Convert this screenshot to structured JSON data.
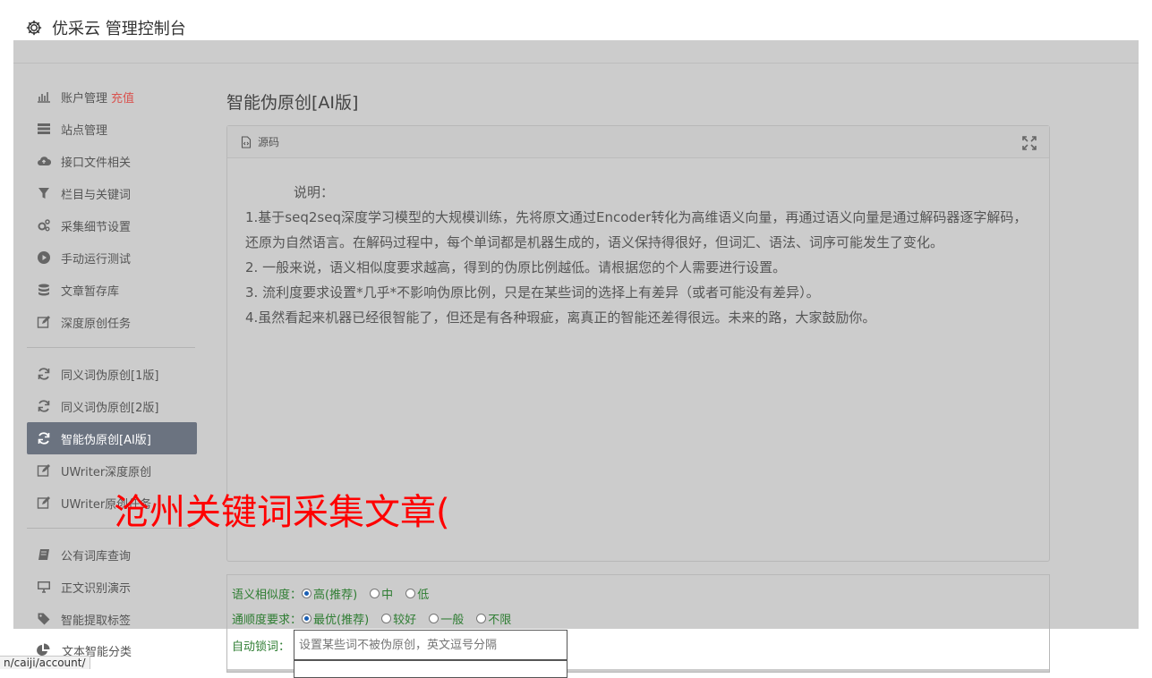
{
  "header": {
    "title": "优采云 管理控制台"
  },
  "sidebar": {
    "items": [
      {
        "label": "账户管理",
        "extra": "充值"
      },
      {
        "label": "站点管理"
      },
      {
        "label": "接口文件相关"
      },
      {
        "label": "栏目与关键词"
      },
      {
        "label": "采集细节设置"
      },
      {
        "label": "手动运行测试"
      },
      {
        "label": "文章暂存库"
      },
      {
        "label": "深度原创任务"
      },
      {
        "label": "同义词伪原创[1版]"
      },
      {
        "label": "同义词伪原创[2版]"
      },
      {
        "label": "智能伪原创[AI版]"
      },
      {
        "label": "UWriter深度原创"
      },
      {
        "label": "UWriter原创任务"
      },
      {
        "label": "公有词库查询"
      },
      {
        "label": "正文识别演示"
      },
      {
        "label": "智能提取标签"
      },
      {
        "label": "文本智能分类"
      }
    ],
    "active_index": 10
  },
  "main": {
    "title": "智能伪原创[AI版]",
    "panel": {
      "tab_label": "源码",
      "lines": [
        "　　说明：",
        "1.基于seq2seq深度学习模型的大规模训练，先将原文通过Encoder转化为高维语义向量，再通过语义向量是通过解码器逐字解码，还原为自然语言。在解码过程中，每个单词都是机器生成的，语义保持得很好，但词汇、语法、词序可能发生了变化。",
        "2. 一般来说，语义相似度要求越高，得到的伪原比例越低。请根据您的个人需要进行设置。",
        "3. 流利度要求设置*几乎*不影响伪原比例，只是在某些词的选择上有差异（或者可能没有差异）。",
        "4.虽然看起来机器已经很智能了，但还是有各种瑕疵，离真正的智能还差得很远。未来的路，大家鼓励你。"
      ]
    },
    "settings": {
      "similarity": {
        "label": "语义相似度：",
        "options": [
          "高(推荐)",
          "中",
          "低"
        ],
        "selected": 0
      },
      "fluency": {
        "label": "通顺度要求：",
        "options": [
          "最优(推荐)",
          "较好",
          "一般",
          "不限"
        ],
        "selected": 0
      },
      "lock": {
        "label": "自动锁词：",
        "placeholder": "设置某些词不被伪原创，英文逗号分隔"
      }
    }
  },
  "watermark": "沧州关键词采集文章(",
  "status_url": "n/caiji/account/"
}
